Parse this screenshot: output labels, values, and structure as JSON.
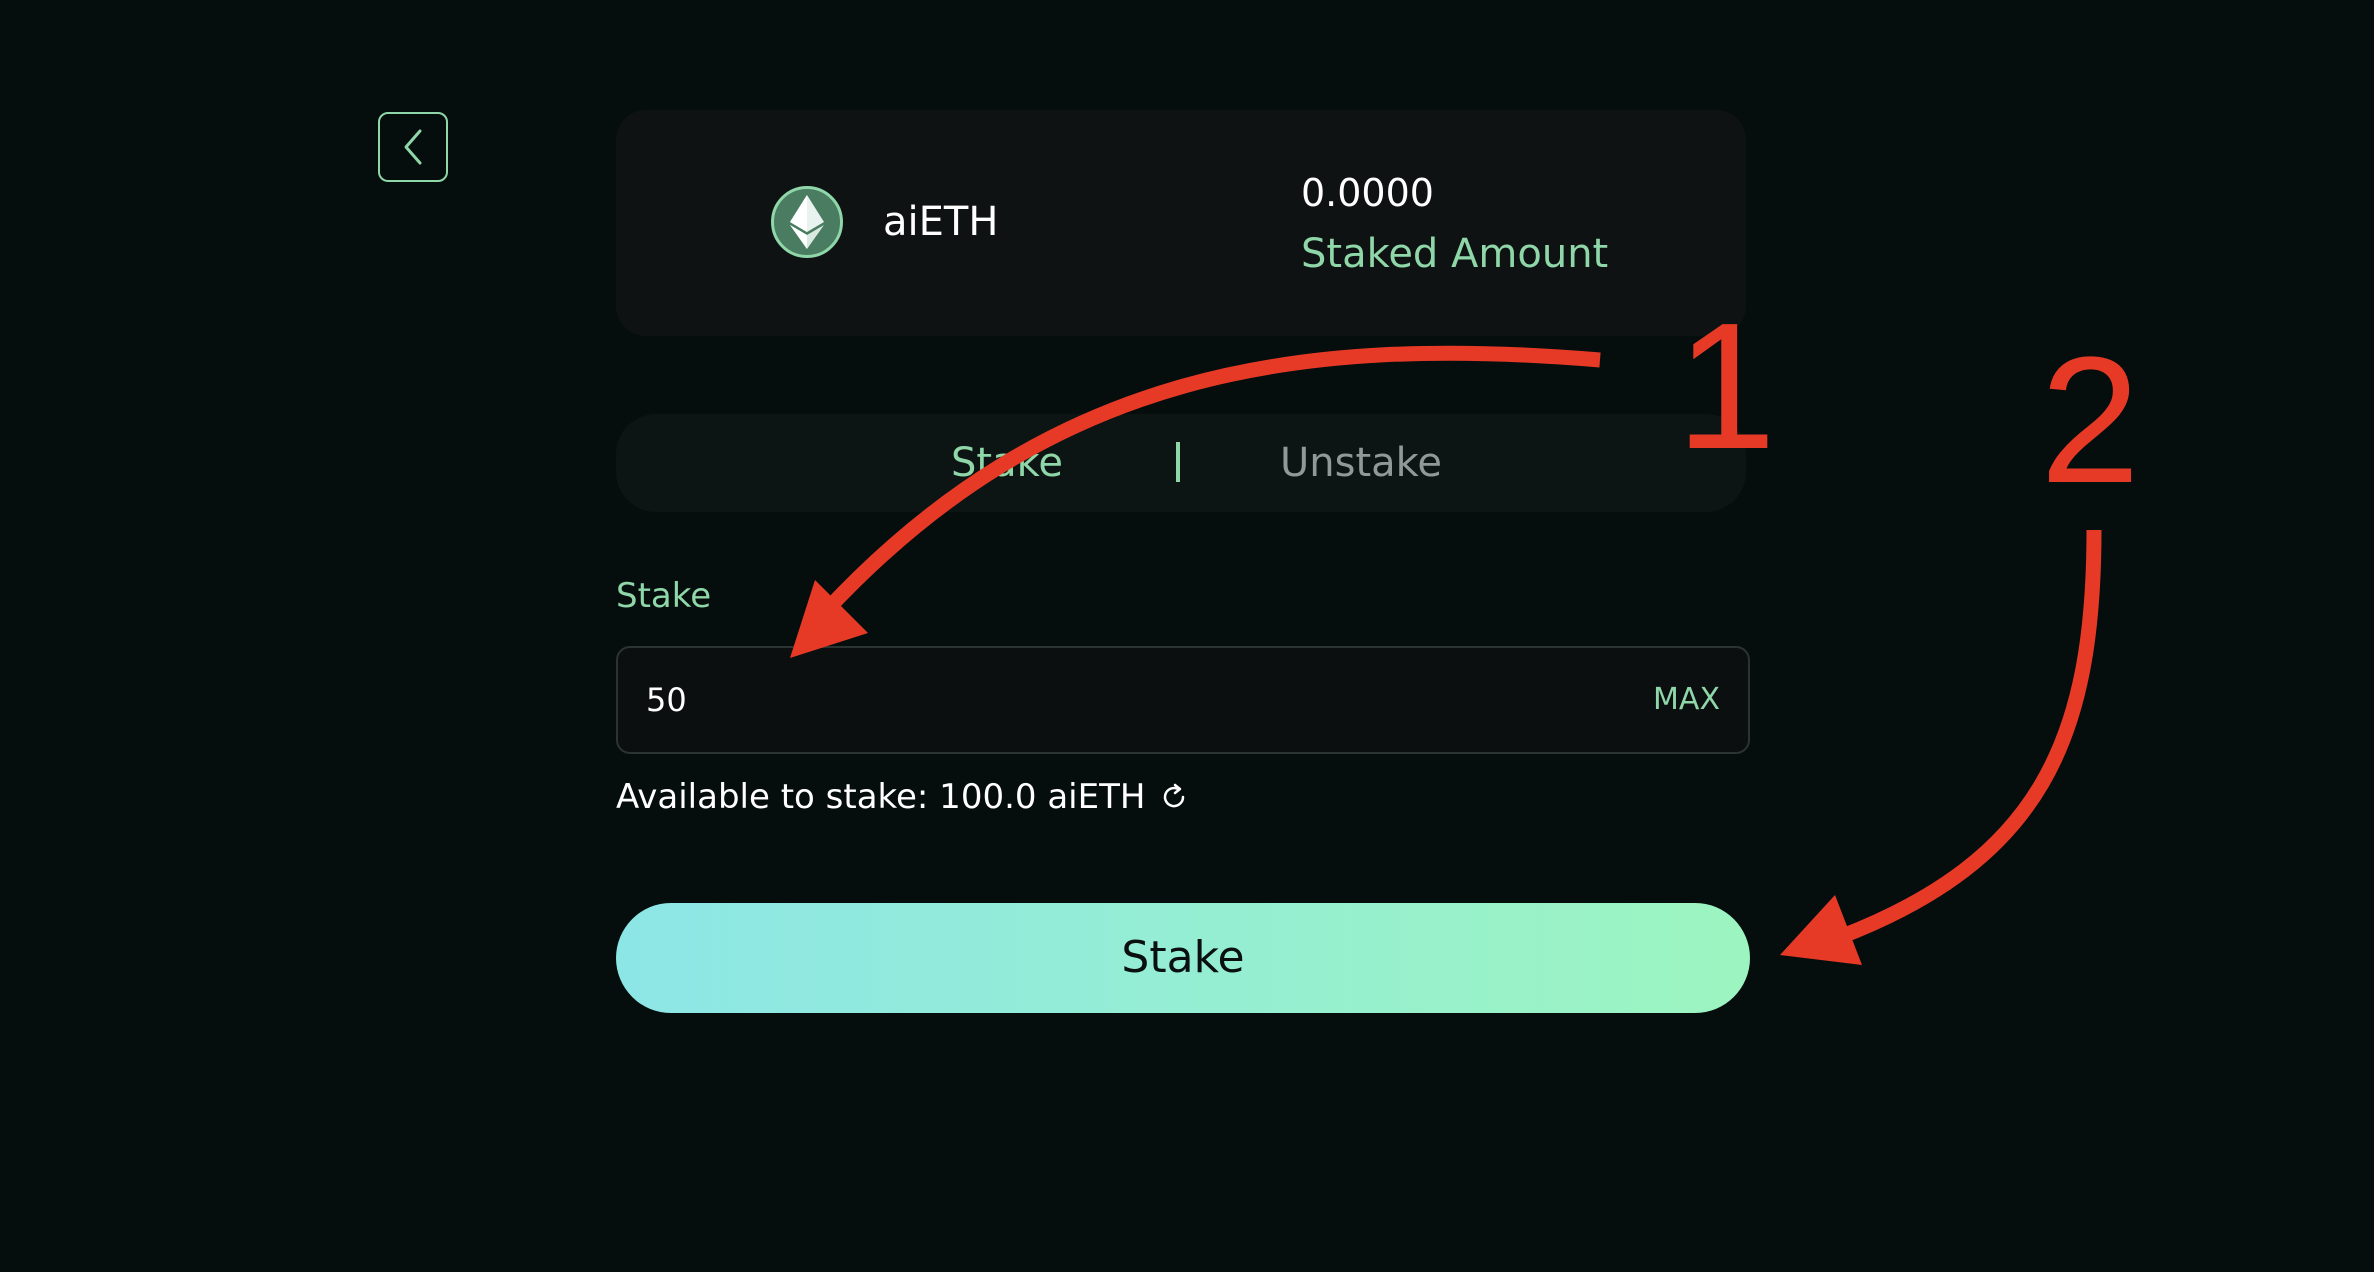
{
  "token": {
    "name": "aiETH",
    "icon": "ethereum-icon",
    "staked_value": "0.0000",
    "staked_label": "Staked Amount"
  },
  "tabs": [
    {
      "label": "Stake",
      "active": true
    },
    {
      "label": "Unstake",
      "active": false
    }
  ],
  "form": {
    "label": "Stake",
    "amount_value": "50",
    "max_label": "MAX",
    "available_text": "Available to stake: 100.0 aiETH"
  },
  "action": {
    "button_label": "Stake"
  },
  "annotations": {
    "step1": "1",
    "step2": "2"
  },
  "colors": {
    "background": "#050d0d",
    "accent": "#8fd6a8",
    "annotation": "#e63a26",
    "button_gradient_start": "#8de6e6",
    "button_gradient_end": "#9cf5c0"
  }
}
